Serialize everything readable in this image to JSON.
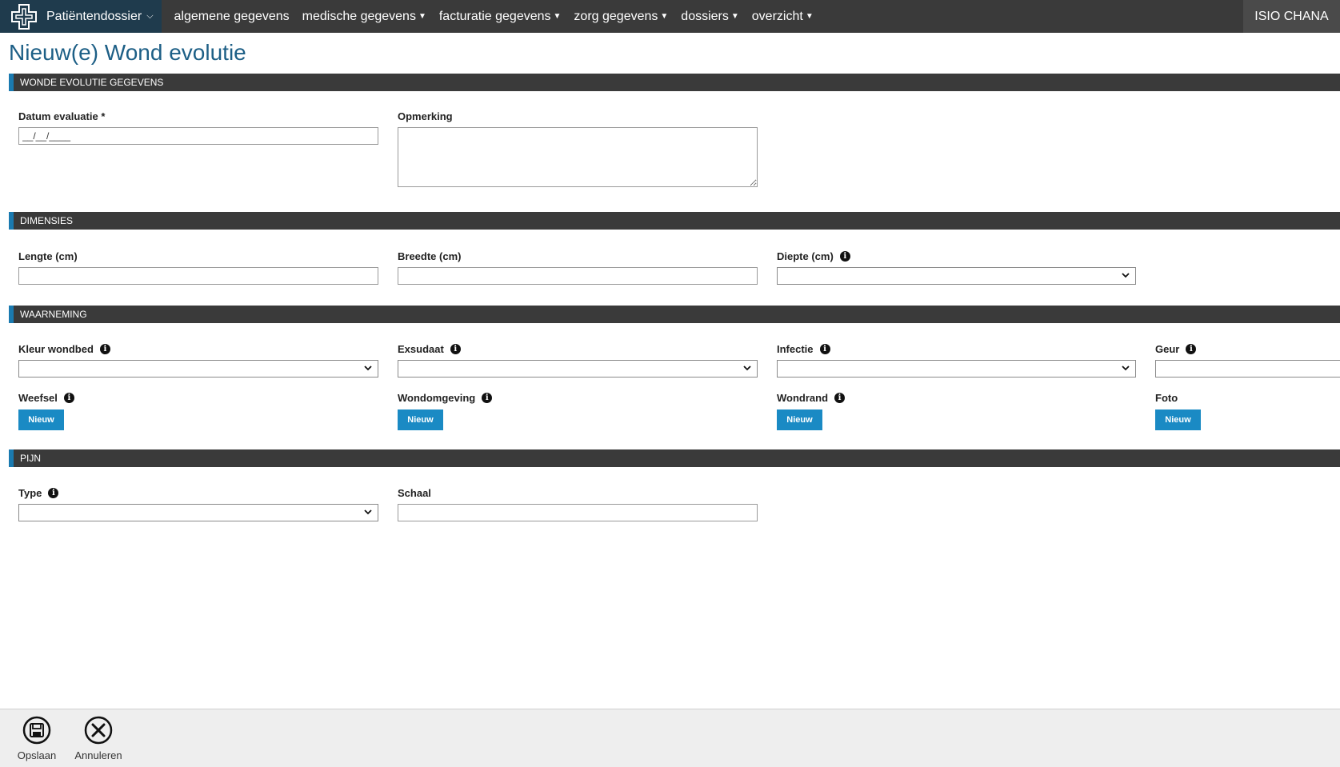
{
  "nav": {
    "brand_label": "Patiëntendossier",
    "items": [
      {
        "label": "algemene gegevens",
        "dropdown": false
      },
      {
        "label": "medische gegevens",
        "dropdown": true
      },
      {
        "label": "facturatie gegevens",
        "dropdown": true
      },
      {
        "label": "zorg gegevens",
        "dropdown": true
      },
      {
        "label": "dossiers",
        "dropdown": true
      },
      {
        "label": "overzicht",
        "dropdown": true
      }
    ],
    "user": "ISIO CHANA"
  },
  "page": {
    "title": "Nieuw(e) Wond evolutie"
  },
  "sections": {
    "evolutie": {
      "title": "WONDE EVOLUTIE GEGEVENS",
      "datum_label": "Datum evaluatie *",
      "datum_value": "__/__/____",
      "opmerking_label": "Opmerking",
      "opmerking_value": ""
    },
    "dimensies": {
      "title": "DIMENSIES",
      "lengte_label": "Lengte (cm)",
      "breedte_label": "Breedte (cm)",
      "diepte_label": "Diepte (cm)"
    },
    "waarneming": {
      "title": "WAARNEMING",
      "kleur_label": "Kleur wondbed",
      "exsudaat_label": "Exsudaat",
      "infectie_label": "Infectie",
      "geur_label": "Geur",
      "weefsel_label": "Weefsel",
      "wondomgeving_label": "Wondomgeving",
      "wondrand_label": "Wondrand",
      "foto_label": "Foto",
      "new_button_label": "Nieuw"
    },
    "pijn": {
      "title": "PIJN",
      "type_label": "Type",
      "schaal_label": "Schaal"
    }
  },
  "footer": {
    "save_label": "Opslaan",
    "cancel_label": "Annuleren"
  },
  "icons": {
    "info": "i",
    "brand": "medical-cross-icon",
    "save": "floppy-disk-icon",
    "cancel": "close-circle-icon"
  },
  "colors": {
    "nav_bg": "#3a3a3a",
    "brand_bg": "#1f3b4d",
    "title": "#1d5f86",
    "accent": "#1a8ac4"
  }
}
